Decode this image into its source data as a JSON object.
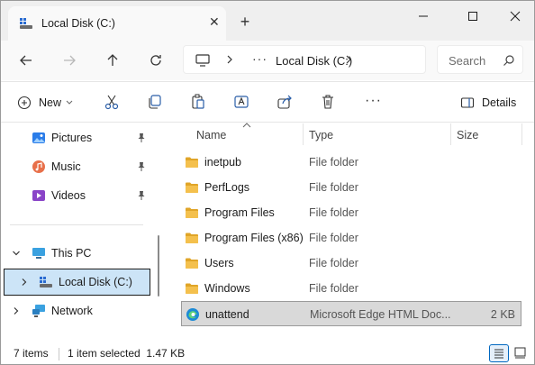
{
  "tab": {
    "title": "Local Disk (C:)"
  },
  "address": {
    "location": "Local Disk (C:)",
    "more": "···"
  },
  "search": {
    "placeholder": "Search"
  },
  "commands": {
    "new_label": "New",
    "details_label": "Details",
    "more": "···"
  },
  "nav": {
    "quick_access": [
      {
        "label": "Pictures",
        "pinned": true
      },
      {
        "label": "Music",
        "pinned": true
      },
      {
        "label": "Videos",
        "pinned": true
      }
    ],
    "this_pc": "This PC",
    "local_disk": "Local Disk (C:)",
    "network": "Network"
  },
  "columns": {
    "name": "Name",
    "type": "Type",
    "size": "Size"
  },
  "files": [
    {
      "name": "inetpub",
      "type": "File folder",
      "size": "",
      "kind": "folder"
    },
    {
      "name": "PerfLogs",
      "type": "File folder",
      "size": "",
      "kind": "folder"
    },
    {
      "name": "Program Files",
      "type": "File folder",
      "size": "",
      "kind": "folder"
    },
    {
      "name": "Program Files (x86)",
      "type": "File folder",
      "size": "",
      "kind": "folder"
    },
    {
      "name": "Users",
      "type": "File folder",
      "size": "",
      "kind": "folder"
    },
    {
      "name": "Windows",
      "type": "File folder",
      "size": "",
      "kind": "folder"
    },
    {
      "name": "unattend",
      "type": "Microsoft Edge HTML Doc...",
      "size": "2 KB",
      "kind": "edge-html",
      "selected": true
    }
  ],
  "status": {
    "items": "7 items",
    "selection": "1 item selected  1.47 KB"
  },
  "colors": {
    "folder": "#f4c04d",
    "folder_dark": "#e0a528",
    "accent": "#0067c0",
    "selection": "#cce4f7"
  }
}
